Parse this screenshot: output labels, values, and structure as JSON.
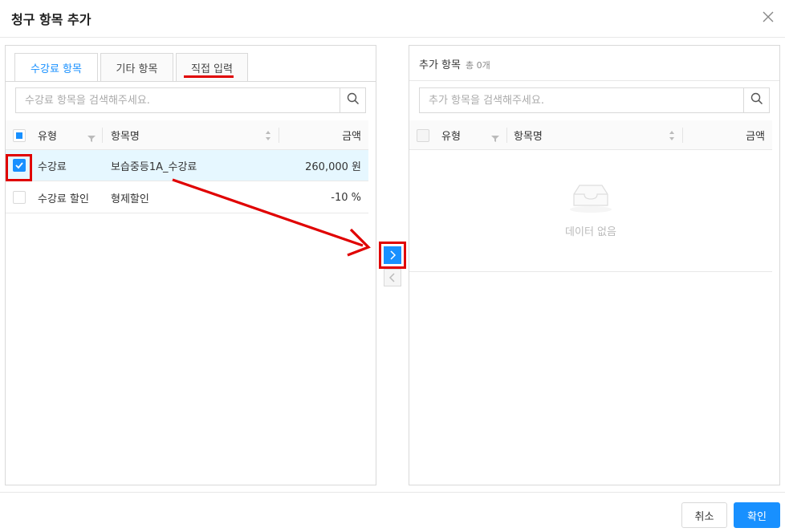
{
  "modal": {
    "title": "청구 항목 추가"
  },
  "left": {
    "tabs": [
      {
        "label": "수강료 항목"
      },
      {
        "label": "기타 항목"
      },
      {
        "label": "직접 입력"
      }
    ],
    "search_placeholder": "수강료 항목을 검색해주세요.",
    "columns": {
      "type": "유형",
      "name": "항목명",
      "amount": "금액"
    },
    "rows": [
      {
        "type": "수강료",
        "name": "보습중등1A_수강료",
        "amount": "260,000 원",
        "checked": true
      },
      {
        "type": "수강료 할인",
        "name": "형제할인",
        "amount": "-10 %",
        "checked": false
      }
    ]
  },
  "right": {
    "title": "추가 항목",
    "count": "총 0개",
    "search_placeholder": "추가 항목을 검색해주세요.",
    "columns": {
      "type": "유형",
      "name": "항목명",
      "amount": "금액"
    },
    "empty_text": "데이터 없음"
  },
  "footer": {
    "cancel_label": "취소",
    "ok_label": "확인"
  },
  "colors": {
    "primary": "#1890ff",
    "annotation": "#e00000"
  }
}
